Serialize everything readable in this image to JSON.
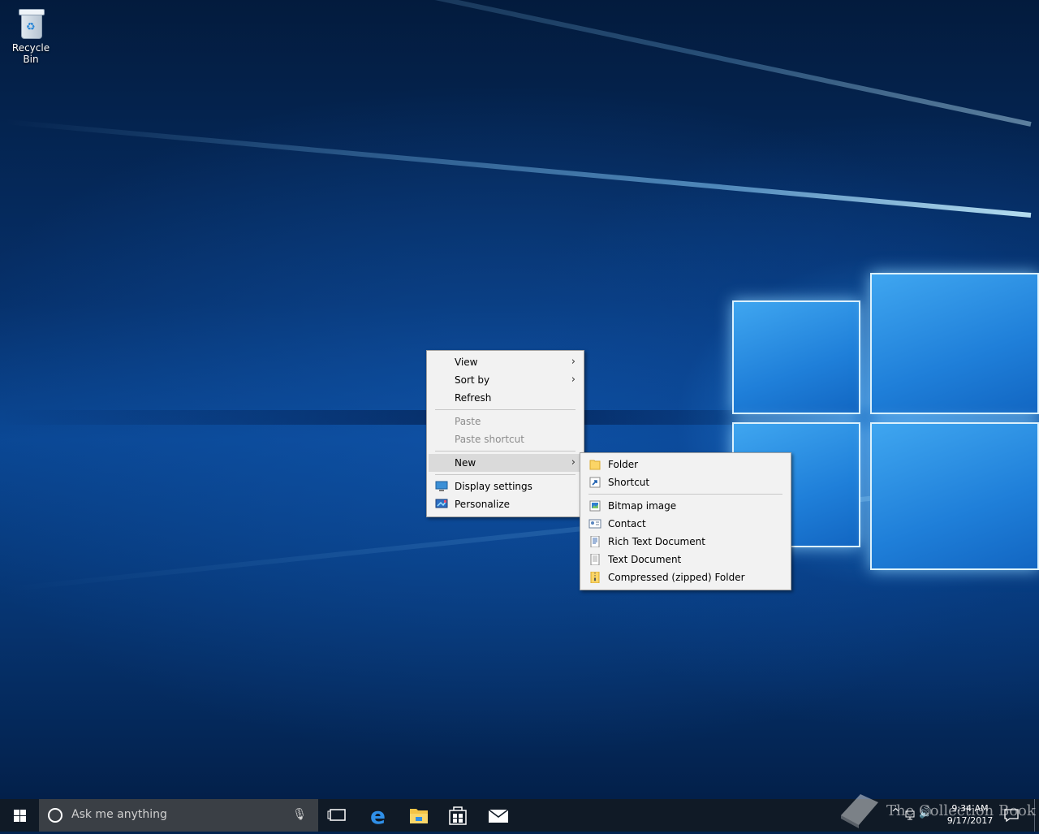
{
  "desktop": {
    "icons": [
      {
        "label": "Recycle Bin",
        "icon": "recycle-bin-icon"
      }
    ]
  },
  "context_menu": {
    "items": [
      {
        "label": "View",
        "submenu": true
      },
      {
        "label": "Sort by",
        "submenu": true
      },
      {
        "label": "Refresh"
      },
      {
        "label": "Paste",
        "disabled": true
      },
      {
        "label": "Paste shortcut",
        "disabled": true
      },
      {
        "label": "New",
        "submenu": true,
        "highlighted": true
      },
      {
        "label": "Display settings",
        "icon": "display-settings-icon"
      },
      {
        "label": "Personalize",
        "icon": "personalize-icon"
      }
    ]
  },
  "new_submenu": {
    "items": [
      {
        "label": "Folder",
        "icon": "folder-icon"
      },
      {
        "label": "Shortcut",
        "icon": "shortcut-icon"
      },
      {
        "label": "Bitmap image",
        "icon": "bitmap-image-icon"
      },
      {
        "label": "Contact",
        "icon": "contact-icon"
      },
      {
        "label": "Rich Text Document",
        "icon": "rich-text-document-icon"
      },
      {
        "label": "Text Document",
        "icon": "text-document-icon"
      },
      {
        "label": "Compressed (zipped) Folder",
        "icon": "zipped-folder-icon"
      }
    ]
  },
  "taskbar": {
    "search_placeholder": "Ask me anything",
    "pinned": [
      "task-view-icon",
      "edge-icon",
      "file-explorer-icon",
      "store-icon",
      "mail-icon"
    ],
    "clock": {
      "time": "9:34 AM",
      "date": "9/17/2017"
    }
  },
  "watermark": "The Collection Book",
  "colors": {
    "taskbar": "#101a26",
    "search_box": "#3a3f45",
    "menu_bg": "#f2f2f2",
    "menu_highlight": "#dadada"
  }
}
